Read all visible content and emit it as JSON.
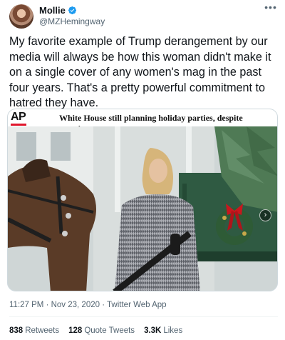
{
  "author": {
    "name": "Mollie",
    "handle": "@MZHemingway",
    "verified": true
  },
  "tweet": {
    "text": "My favorite example of Trump derangement by our media will always be how this woman didn't make it on a single cover of any women's mag in the past four years. That's a pretty powerful commitment to hatred they have."
  },
  "media": {
    "source": "AP",
    "headline": "White House still planning holiday parties, despite warnings"
  },
  "meta": {
    "time": "11:27 PM",
    "date": "Nov 23, 2020",
    "client": "Twitter Web App",
    "separator": " · "
  },
  "stats": {
    "retweets_count": "838",
    "retweets_label": "Retweets",
    "quotes_count": "128",
    "quotes_label": "Quote Tweets",
    "likes_count": "3.3K",
    "likes_label": "Likes"
  },
  "colors": {
    "text": "#0f1419",
    "secondary": "#536471",
    "verified": "#1d9bf0",
    "ap_red": "#e0182d"
  },
  "icons": [
    "verified-badge-icon",
    "more-options-icon",
    "next-slide-icon"
  ]
}
